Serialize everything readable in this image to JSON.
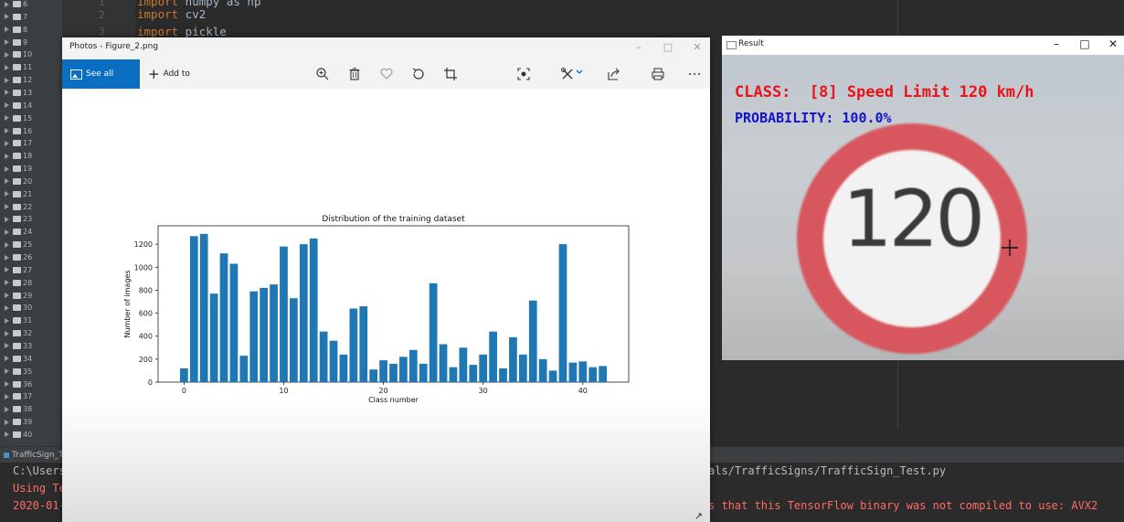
{
  "ide": {
    "tree_items": [
      "6",
      "7",
      "8",
      "9",
      "10",
      "11",
      "12",
      "13",
      "14",
      "15",
      "16",
      "17",
      "18",
      "19",
      "20",
      "21",
      "22",
      "23",
      "24",
      "25",
      "26",
      "27",
      "28",
      "29",
      "30",
      "31",
      "32",
      "33",
      "34",
      "35",
      "36",
      "37",
      "38",
      "39",
      "40"
    ],
    "line_numbers": [
      "1",
      "2",
      "3"
    ],
    "code_lines": [
      {
        "kw": "import",
        "rest": " numpy as np"
      },
      {
        "kw": "import",
        "rest": " cv2"
      },
      {
        "kw": "import",
        "rest": " pickle"
      }
    ]
  },
  "run_panel": {
    "tab_label": "TrafficSign_Te",
    "console": {
      "line1_left": "C:\\Users",
      "line1_right": "als/TrafficSigns/TrafficSign_Test.py",
      "line2_left": "Using Te",
      "line3_left": "2020-01-",
      "line3_right": "s that this TensorFlow binary was not compiled to use: AVX2"
    }
  },
  "photos_window": {
    "title": "Photos - Figure_2.png",
    "see_all_label": "See all photos",
    "add_to_label": "Add to",
    "toolbar_icons": [
      "zoom-in-icon",
      "delete-icon",
      "heart-icon",
      "rotate-icon",
      "crop-icon",
      "enhance-icon",
      "edit-icon",
      "share-icon",
      "print-icon",
      "more-icon"
    ]
  },
  "result_window": {
    "title": "Result",
    "class_text": "CLASS:  [8] Speed Limit 120 km/h",
    "probability_text": "PROBABILITY: 100.0%",
    "sign_text": "120",
    "colors": {
      "class": "#e8141a",
      "probability": "#1414c8",
      "sign_ring": "#d8575f"
    }
  },
  "chart_data": {
    "type": "bar",
    "title": "Distribution of the training dataset",
    "xlabel": "Class number",
    "ylabel": "Number of images",
    "x": [
      0,
      1,
      2,
      3,
      4,
      5,
      6,
      7,
      8,
      9,
      10,
      11,
      12,
      13,
      14,
      15,
      16,
      17,
      18,
      19,
      20,
      21,
      22,
      23,
      24,
      25,
      26,
      27,
      28,
      29,
      30,
      31,
      32,
      33,
      34,
      35,
      36,
      37,
      38,
      39,
      40,
      41,
      42
    ],
    "values": [
      120,
      1270,
      1290,
      770,
      1120,
      1030,
      230,
      790,
      820,
      850,
      1180,
      730,
      1200,
      1250,
      440,
      360,
      240,
      640,
      660,
      110,
      190,
      160,
      220,
      280,
      160,
      860,
      330,
      130,
      300,
      150,
      240,
      440,
      120,
      390,
      240,
      710,
      200,
      100,
      1200,
      170,
      180,
      130,
      140
    ],
    "xticks": [
      0,
      10,
      20,
      30,
      40
    ],
    "yticks": [
      0,
      200,
      400,
      600,
      800,
      1000,
      1200
    ],
    "ylim": [
      0,
      1360
    ],
    "xlim": [
      -2.6,
      44.6
    ],
    "bar_color": "#1f77b4"
  }
}
